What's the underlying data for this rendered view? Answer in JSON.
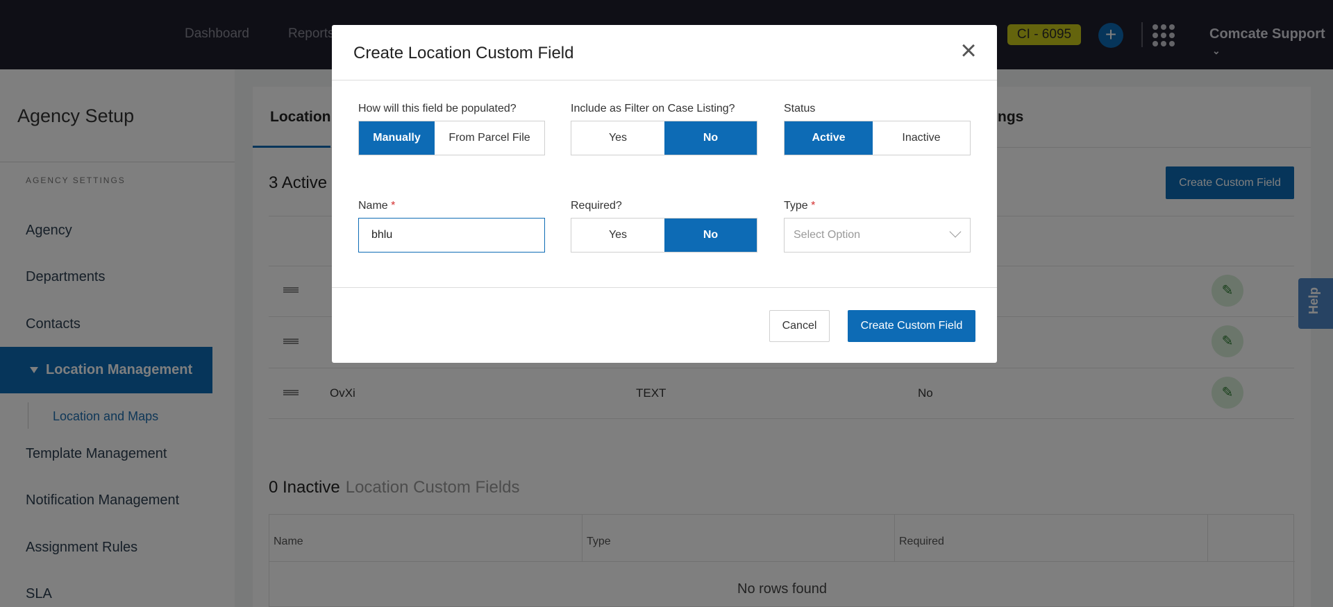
{
  "topbar": {
    "nav": [
      "Dashboard",
      "Reports"
    ],
    "badge": "CI - 6095",
    "user": "Comcate Support"
  },
  "sidebar": {
    "title": "Agency Setup",
    "section": "AGENCY SETTINGS",
    "items": [
      "Agency",
      "Departments",
      "Contacts",
      "Location Management",
      "Template Management",
      "Notification Management",
      "Assignment Rules",
      "SLA"
    ],
    "sub_item": "Location and Maps"
  },
  "main": {
    "tab_active": "Location",
    "tab_right": "ngs",
    "active_count": "3 Active",
    "create_button": "Create Custom Field",
    "rows": [
      {
        "name": "OvXi",
        "type": "TEXT",
        "required": "No"
      }
    ],
    "inactive_count": "0 Inactive",
    "inactive_sub": "Location Custom Fields",
    "columns": [
      "Name",
      "Type",
      "Required"
    ],
    "empty": "No rows found"
  },
  "help": "Help",
  "modal": {
    "title": "Create Location Custom Field",
    "populated": {
      "label": "How will this field be populated?",
      "options": [
        "Manually",
        "From Parcel File"
      ],
      "selected": "Manually"
    },
    "filter": {
      "label": "Include as Filter on Case Listing?",
      "options": [
        "Yes",
        "No"
      ],
      "selected": "No"
    },
    "status": {
      "label": "Status",
      "options": [
        "Active",
        "Inactive"
      ],
      "selected": "Active"
    },
    "name": {
      "label": "Name",
      "value": "bhlu"
    },
    "required": {
      "label": "Required?",
      "options": [
        "Yes",
        "No"
      ],
      "selected": "No"
    },
    "type": {
      "label": "Type",
      "placeholder": "Select Option"
    },
    "cancel": "Cancel",
    "create": "Create Custom Field"
  },
  "colors": {
    "accent": "#0d6bb5",
    "topbar": "#1e1e2c",
    "badge": "#c8c81a"
  }
}
